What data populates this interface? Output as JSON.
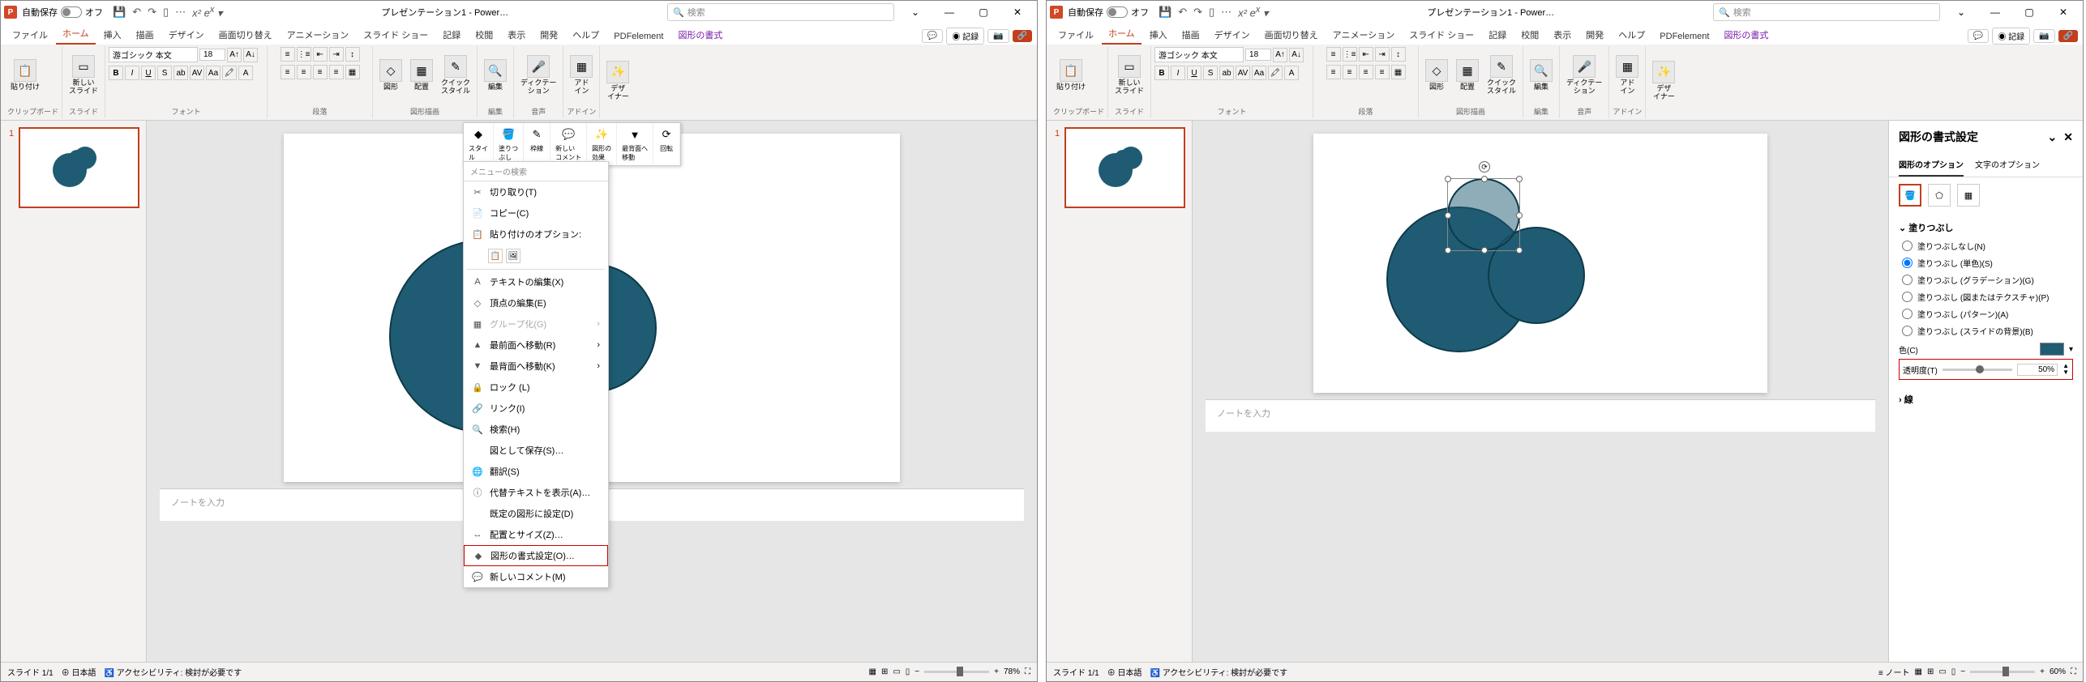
{
  "titlebar": {
    "autosave_label": "自動保存",
    "autosave_state": "オフ",
    "doc_title": "プレゼンテーション1 - Power…",
    "search_placeholder": "検索"
  },
  "tabs": {
    "file": "ファイル",
    "home": "ホーム",
    "insert": "挿入",
    "draw": "描画",
    "design": "デザイン",
    "transitions": "画面切り替え",
    "animations": "アニメーション",
    "slideshow": "スライド ショー",
    "record": "記録",
    "review": "校閲",
    "view": "表示",
    "developer": "開発",
    "help": "ヘルプ",
    "pdf": "PDFelement",
    "format": "図形の書式",
    "rec_btn": "記録"
  },
  "ribbon": {
    "clipboard": {
      "paste": "貼り付け",
      "label": "クリップボード"
    },
    "slides": {
      "new_slide": "新しい\nスライド",
      "label": "スライド"
    },
    "font": {
      "name": "游ゴシック 本文",
      "size": "18",
      "label": "フォント"
    },
    "paragraph": {
      "label": "段落"
    },
    "drawing": {
      "shapes": "図形",
      "arrange": "配置",
      "quick": "クイック\nスタイル",
      "label": "図形描画"
    },
    "editing": {
      "find": "編集",
      "label": "編集"
    },
    "voice": {
      "dictate": "ディクテー\nション",
      "label": "音声"
    },
    "addins": {
      "addin": "アド\nイン",
      "label": "アドイン"
    },
    "designer": {
      "designer": "デザ\nイナー"
    }
  },
  "mini_toolbar": {
    "style": "スタイ\nル",
    "fill": "塗りつ\nぶし",
    "outline": "枠線",
    "comment": "新しい\nコメント",
    "effects": "図形の\n効果",
    "back": "最背面へ\n移動",
    "rotate": "回転"
  },
  "context_menu": {
    "search": "メニューの検索",
    "cut": "切り取り(T)",
    "copy": "コピー(C)",
    "paste_opts": "貼り付けのオプション:",
    "edit_text": "テキストの編集(X)",
    "edit_points": "頂点の編集(E)",
    "group": "グループ化(G)",
    "bring_front": "最前面へ移動(R)",
    "send_back": "最背面へ移動(K)",
    "lock": "ロック (L)",
    "link": "リンク(I)",
    "search_h": "検索(H)",
    "save_pic": "図として保存(S)…",
    "translate": "翻訳(S)",
    "alt_text": "代替テキストを表示(A)…",
    "default": "既定の図形に設定(D)",
    "size": "配置とサイズ(Z)…",
    "format_shape": "図形の書式設定(O)…",
    "new_comment": "新しいコメント(M)"
  },
  "notes": {
    "placeholder": "ノートを入力"
  },
  "statusbar": {
    "slide": "スライド 1/1",
    "lang": "日本語",
    "a11y": "アクセシビリティ: 検討が必要です",
    "notes_btn": "ノート",
    "zoom_l": "78%",
    "zoom_r": "60%"
  },
  "format_pane": {
    "title": "図形の書式設定",
    "tab_shape": "図形のオプション",
    "tab_text": "文字のオプション",
    "fill_section": "塗りつぶし",
    "fill_none": "塗りつぶしなし(N)",
    "fill_solid": "塗りつぶし (単色)(S)",
    "fill_grad": "塗りつぶし (グラデーション)(G)",
    "fill_pic": "塗りつぶし (図またはテクスチャ)(P)",
    "fill_pattern": "塗りつぶし (パターン)(A)",
    "fill_slide": "塗りつぶし (スライドの背景)(B)",
    "color_label": "色(C)",
    "transparency_label": "透明度(T)",
    "transparency_value": "50%",
    "line_section": "線"
  },
  "thumb_num": "1"
}
